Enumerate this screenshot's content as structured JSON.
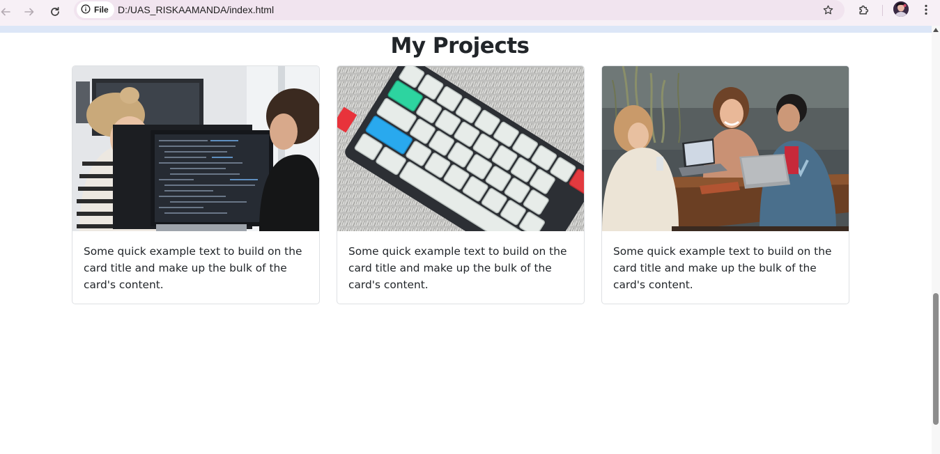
{
  "browser": {
    "chip_label": "File",
    "url": "D:/UAS_RISKAAMANDA/index.html",
    "icons": [
      "back-arrow-icon",
      "forward-arrow-icon",
      "reload-icon",
      "info-icon",
      "star-icon",
      "extensions-puzzle-icon",
      "profile-avatar-icon",
      "kebab-menu-icon"
    ],
    "accent": "#f1e4ef"
  },
  "page": {
    "title": "My Projects"
  },
  "cards": [
    {
      "image": "two developers coding at monitors",
      "text": "Some quick example text to build on the card title and make up the bulk of the card's content."
    },
    {
      "image": "mechanical keyboard on fluffy rug",
      "text": "Some quick example text to build on the card title and make up the bulk of the card's content."
    },
    {
      "image": "three friends laughing at cafe table with laptops",
      "text": "Some quick example text to build on the card title and make up the bulk of the card's content."
    }
  ]
}
